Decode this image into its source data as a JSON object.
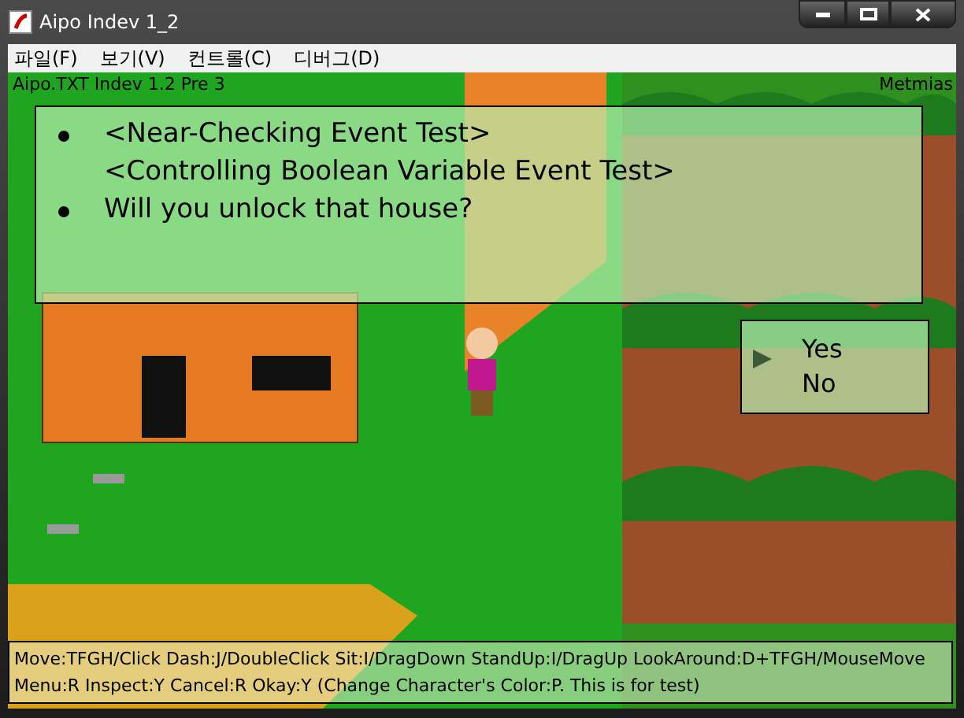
{
  "window": {
    "title": "Aipo Indev 1_2"
  },
  "menu": [
    {
      "label": "파일(F)"
    },
    {
      "label": "보기(V)"
    },
    {
      "label": "컨트롤(C)"
    },
    {
      "label": "디버그(D)"
    }
  ],
  "hud": {
    "left": "Aipo.TXT Indev 1.2 Pre 3",
    "right": "Metmias"
  },
  "dialog": {
    "lines": [
      {
        "text": "<Near-Checking Event Test>",
        "bullet": true
      },
      {
        "text": "<Controlling Boolean Variable Event Test>",
        "bullet": false
      },
      {
        "text": "Will you unlock that house?",
        "bullet": true
      }
    ]
  },
  "choices": [
    {
      "label": "Yes",
      "selected": true
    },
    {
      "label": "No",
      "selected": false
    }
  ],
  "help": [
    "Move:TFGH/Click Dash:J/DoubleClick Sit:I/DragDown StandUp:I/DragUp LookAround:D+TFGH/MouseMove",
    "Menu:R Inspect:Y Cancel:R Okay:Y  (Change Character's Color:P. This is for test)"
  ]
}
